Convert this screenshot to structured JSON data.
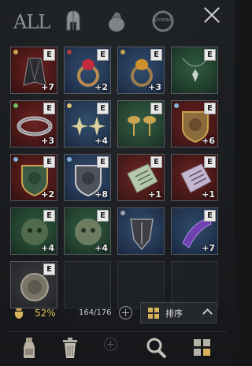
{
  "header": {
    "tab_all": "ALL",
    "tab_accessory_badge": "Access"
  },
  "inventory": {
    "slots": [
      {
        "name": "cloak",
        "bg": "red",
        "badge": "E",
        "count": "+7",
        "gem": "#c9a24b"
      },
      {
        "name": "ruby-ring",
        "bg": "blue",
        "badge": "E",
        "count": "+2",
        "gem": "#b23a3a"
      },
      {
        "name": "amber-ring",
        "bg": "blue",
        "badge": "E",
        "count": "+3",
        "gem": "#c9a24b"
      },
      {
        "name": "emerald-pendant",
        "bg": "green",
        "badge": "E",
        "count": "",
        "gem": ""
      },
      {
        "name": "silver-bracelet",
        "bg": "red",
        "badge": "E",
        "count": "+3",
        "gem": "#6fbf5a"
      },
      {
        "name": "star-earrings",
        "bg": "blue",
        "badge": "E",
        "count": "+4",
        "gem": "#d9c16b"
      },
      {
        "name": "eye-earrings",
        "bg": "green",
        "badge": "E",
        "count": "",
        "gem": ""
      },
      {
        "name": "dragon-crest-shield",
        "bg": "red",
        "badge": "E",
        "count": "+6",
        "gem": "#7fb0d9"
      },
      {
        "name": "lion-crest-shield",
        "bg": "red",
        "badge": "E",
        "count": "+2",
        "gem": "#7fb0d9"
      },
      {
        "name": "dragon-crest-shield-2",
        "bg": "blue",
        "badge": "E",
        "count": "+8",
        "gem": "#7fb0d9"
      },
      {
        "name": "green-rune-tablet",
        "bg": "red",
        "badge": "E",
        "count": "+1",
        "gem": ""
      },
      {
        "name": "purple-rune-tablet",
        "bg": "red",
        "badge": "E",
        "count": "+1",
        "gem": ""
      },
      {
        "name": "green-skull-relic",
        "bg": "green",
        "badge": "E",
        "count": "+4",
        "gem": ""
      },
      {
        "name": "bone-skull-relic",
        "bg": "green",
        "badge": "E",
        "count": "+4",
        "gem": ""
      },
      {
        "name": "dark-crest",
        "bg": "blue",
        "badge": "",
        "count": "",
        "gem": "#9aa0a6"
      },
      {
        "name": "amethyst-gauntlet",
        "bg": "blue",
        "badge": "E",
        "count": "+7",
        "gem": ""
      },
      {
        "name": "stone-lion-crest",
        "bg": "gray",
        "badge": "E",
        "count": "",
        "gem": ""
      }
    ],
    "empty_slots": 3
  },
  "status": {
    "weight_percent": "52%",
    "capacity": "164/176",
    "sort_label": "排序"
  },
  "colors": {
    "accent_gold": "#e4c05a",
    "close": "#d8d8d8"
  }
}
